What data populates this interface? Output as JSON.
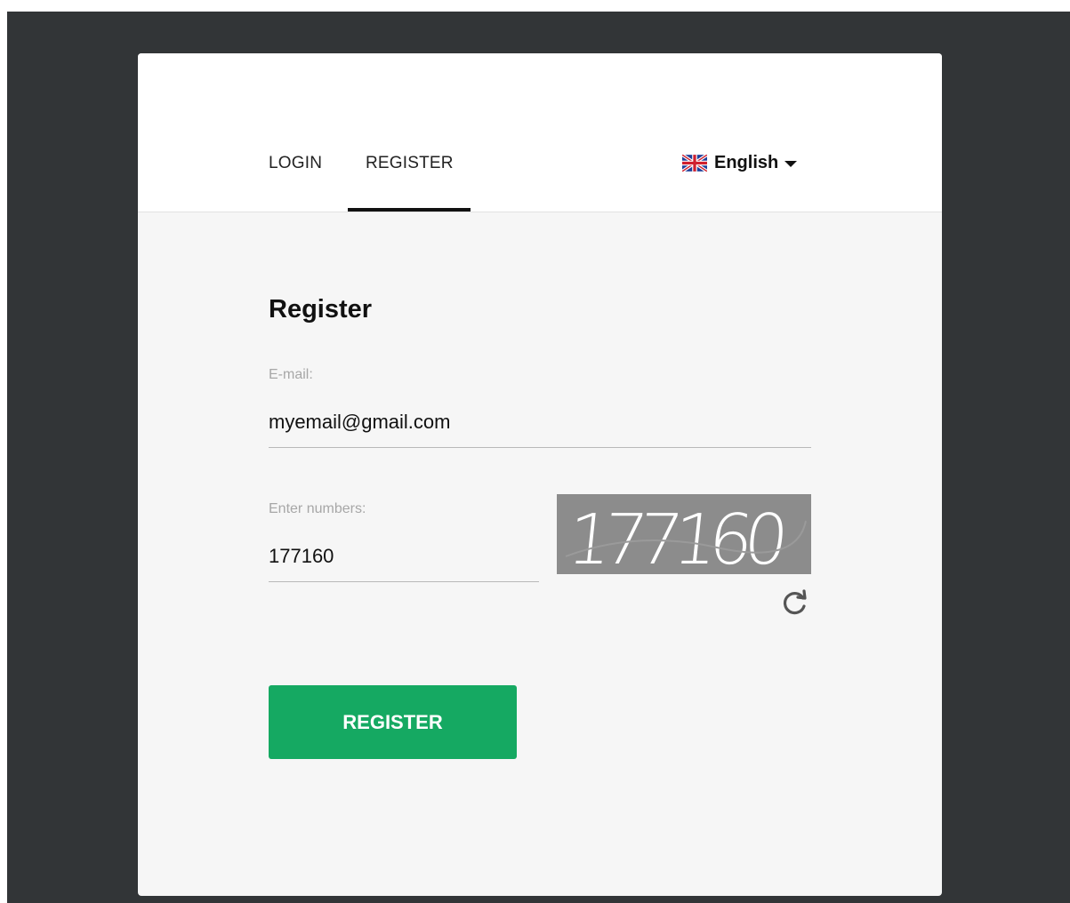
{
  "tabs": {
    "login_label": "LOGIN",
    "register_label": "REGISTER",
    "active": "REGISTER"
  },
  "language": {
    "label": "English",
    "flag_icon": "uk-flag-icon",
    "dropdown_icon": "caret-down-icon"
  },
  "form": {
    "title": "Register",
    "email": {
      "label": "E-mail:",
      "value": "myemail@gmail.com"
    },
    "captcha": {
      "label": "Enter numbers:",
      "value": "177160",
      "image_text": "177160",
      "refresh_icon": "refresh-icon"
    },
    "submit_label": "REGISTER"
  },
  "colors": {
    "page_background": "#323537",
    "card_background": "#f6f6f6",
    "header_background": "#ffffff",
    "primary_button": "#15a962",
    "captcha_background": "#8c8c8c",
    "label_text": "#a7a7a7"
  }
}
